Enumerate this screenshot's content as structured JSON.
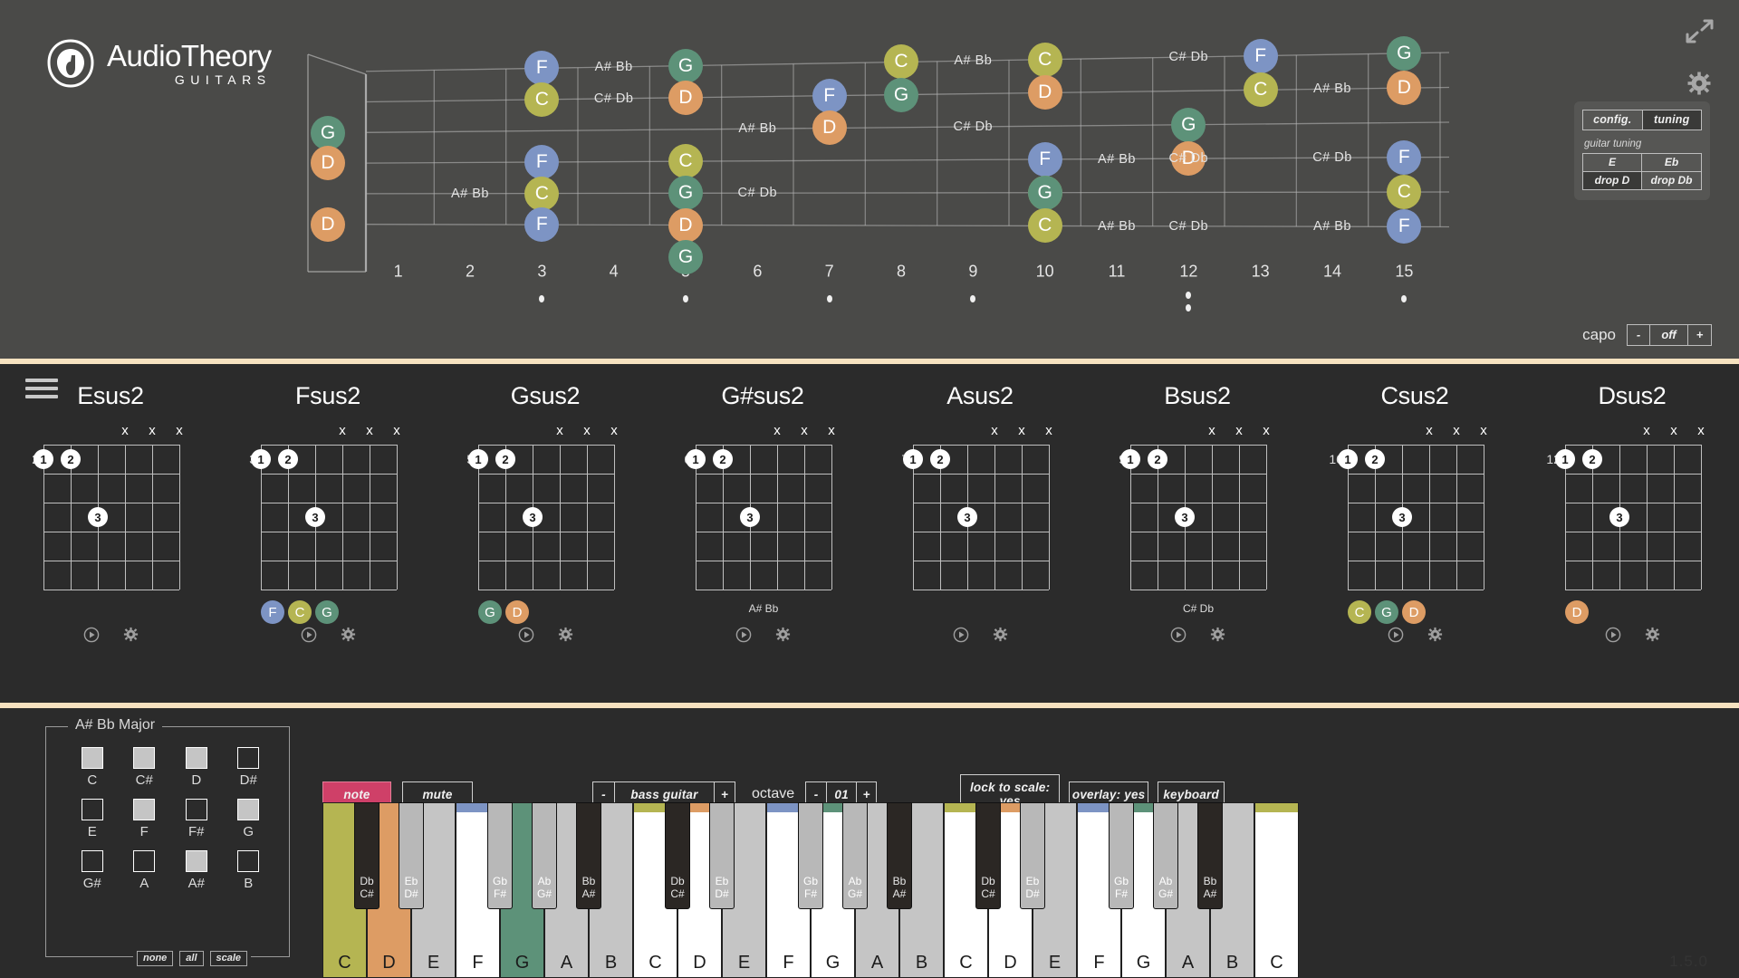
{
  "app": {
    "logo_main": "AudioTheory",
    "logo_sub": "GUITARS",
    "version": "1.5.0"
  },
  "colors": {
    "note_C": "#b5b552",
    "note_D": "#dd9c64",
    "note_F": "#7d94c4",
    "note_G": "#5d9279",
    "accent_pink": "#cf4068",
    "panel_bg": "#4a4a48",
    "dark_bg": "#2b2b2b",
    "cream": "#f6e2c0"
  },
  "fretboard": {
    "fret_numbers": [
      "1",
      "2",
      "3",
      "4",
      "5",
      "6",
      "7",
      "8",
      "9",
      "10",
      "11",
      "12",
      "13",
      "14",
      "15"
    ],
    "inlay_frets": [
      3,
      5,
      7,
      9,
      12,
      15
    ],
    "open_notes": [
      "G",
      "D",
      "D"
    ],
    "notes": [
      {
        "label": "G",
        "fret": 0,
        "string": 2
      },
      {
        "label": "D",
        "fret": 0,
        "string": 3
      },
      {
        "label": "D",
        "fret": 0,
        "string": 5
      },
      {
        "label": "F",
        "fret": 3,
        "string": 0
      },
      {
        "label": "C",
        "fret": 3,
        "string": 1
      },
      {
        "label": "F",
        "fret": 3,
        "string": 3
      },
      {
        "label": "C",
        "fret": 3,
        "string": 4
      },
      {
        "label": "F",
        "fret": 3,
        "string": 5
      },
      {
        "label": "G",
        "fret": 5,
        "string": 0
      },
      {
        "label": "D",
        "fret": 5,
        "string": 1
      },
      {
        "label": "C",
        "fret": 5,
        "string": 3
      },
      {
        "label": "G",
        "fret": 5,
        "string": 4
      },
      {
        "label": "D",
        "fret": 5,
        "string": 5
      },
      {
        "label": "G",
        "fret": 5,
        "string": 6
      },
      {
        "label": "F",
        "fret": 7,
        "string": 1
      },
      {
        "label": "C",
        "fret": 8,
        "string": 0
      },
      {
        "label": "G",
        "fret": 8,
        "string": 1
      },
      {
        "label": "D",
        "fret": 7,
        "string": 2
      },
      {
        "label": "C",
        "fret": 10,
        "string": 0
      },
      {
        "label": "D",
        "fret": 10,
        "string": 1
      },
      {
        "label": "F",
        "fret": 10,
        "string": 3
      },
      {
        "label": "C",
        "fret": 10,
        "string": 4
      },
      {
        "label": "G",
        "fret": 10,
        "string": 4
      },
      {
        "label": "C",
        "fret": 10,
        "string": 5
      },
      {
        "label": "F",
        "fret": 13,
        "string": 0
      },
      {
        "label": "C",
        "fret": 13,
        "string": 1
      },
      {
        "label": "G",
        "fret": 12,
        "string": 2
      },
      {
        "label": "D",
        "fret": 12,
        "string": 3
      },
      {
        "label": "G",
        "fret": 15,
        "string": 0
      },
      {
        "label": "D",
        "fret": 15,
        "string": 1
      },
      {
        "label": "F",
        "fret": 15,
        "string": 3
      },
      {
        "label": "C",
        "fret": 15,
        "string": 4
      },
      {
        "label": "F",
        "fret": 15,
        "string": 5
      }
    ],
    "accidentals": [
      {
        "label": "C# Db",
        "fret": 4,
        "string": 1
      },
      {
        "label": "A# Bb",
        "fret": 4,
        "string": 0
      },
      {
        "label": "A# Bb",
        "fret": 2,
        "string": 4
      },
      {
        "label": "A# Bb",
        "fret": 6,
        "string": 2
      },
      {
        "label": "C# Db",
        "fret": 6,
        "string": 4
      },
      {
        "label": "A# Bb",
        "fret": 9,
        "string": 0
      },
      {
        "label": "C# Db",
        "fret": 9,
        "string": 2
      },
      {
        "label": "A# Bb",
        "fret": 11,
        "string": 3
      },
      {
        "label": "A# Bb",
        "fret": 11,
        "string": 5
      },
      {
        "label": "C# Db",
        "fret": 12,
        "string": 0
      },
      {
        "label": "C# Db",
        "fret": 12,
        "string": 3
      },
      {
        "label": "C# Db",
        "fret": 12,
        "string": 5
      },
      {
        "label": "A# Bb",
        "fret": 14,
        "string": 1
      },
      {
        "label": "C# Db",
        "fret": 14,
        "string": 3
      },
      {
        "label": "A# Bb",
        "fret": 14,
        "string": 5
      }
    ]
  },
  "top_controls": {
    "expand_icon": "expand-arrows-icon",
    "gear_icon": "gear-icon",
    "tabs": [
      {
        "label": "config.",
        "active": false
      },
      {
        "label": "tuning",
        "active": true
      }
    ],
    "tuning_label": "guitar tuning",
    "tuning_options": [
      {
        "label": "E",
        "active": false
      },
      {
        "label": "Eb",
        "active": false
      },
      {
        "label": "drop D",
        "active": true
      },
      {
        "label": "drop Db",
        "active": false
      }
    ],
    "capo_label": "capo",
    "capo_minus": "-",
    "capo_value": "off",
    "capo_plus": "+"
  },
  "chords": [
    {
      "name": "Esus2",
      "start_fret": "2",
      "mutes": [
        "x",
        "x",
        "x"
      ],
      "mute_strings": [
        3,
        4,
        5
      ],
      "fingers": [
        {
          "n": "1",
          "string": 0,
          "fret": 0
        },
        {
          "n": "2",
          "string": 1,
          "fret": 0
        },
        {
          "n": "3",
          "string": 2,
          "fret": 2
        }
      ],
      "notes": [],
      "accidental": ""
    },
    {
      "name": "Fsus2",
      "start_fret": "3",
      "mutes": [
        "x",
        "x",
        "x"
      ],
      "mute_strings": [
        3,
        4,
        5
      ],
      "fingers": [
        {
          "n": "1",
          "string": 0,
          "fret": 0
        },
        {
          "n": "2",
          "string": 1,
          "fret": 0
        },
        {
          "n": "3",
          "string": 2,
          "fret": 2
        }
      ],
      "notes": [
        "F",
        "C",
        "G"
      ],
      "accidental": ""
    },
    {
      "name": "Gsus2",
      "start_fret": "5",
      "mutes": [
        "x",
        "x",
        "x"
      ],
      "mute_strings": [
        3,
        4,
        5
      ],
      "fingers": [
        {
          "n": "1",
          "string": 0,
          "fret": 0
        },
        {
          "n": "2",
          "string": 1,
          "fret": 0
        },
        {
          "n": "3",
          "string": 2,
          "fret": 2
        }
      ],
      "notes": [
        "G",
        "D"
      ],
      "accidental": ""
    },
    {
      "name": "G#sus2",
      "start_fret": "6",
      "mutes": [
        "x",
        "x",
        "x"
      ],
      "mute_strings": [
        3,
        4,
        5
      ],
      "fingers": [
        {
          "n": "1",
          "string": 0,
          "fret": 0
        },
        {
          "n": "2",
          "string": 1,
          "fret": 0
        },
        {
          "n": "3",
          "string": 2,
          "fret": 2
        }
      ],
      "notes": [],
      "accidental": "A# Bb"
    },
    {
      "name": "Asus2",
      "start_fret": "7",
      "mutes": [
        "x",
        "x",
        "x"
      ],
      "mute_strings": [
        3,
        4,
        5
      ],
      "fingers": [
        {
          "n": "1",
          "string": 0,
          "fret": 0
        },
        {
          "n": "2",
          "string": 1,
          "fret": 0
        },
        {
          "n": "3",
          "string": 2,
          "fret": 2
        }
      ],
      "notes": [],
      "accidental": ""
    },
    {
      "name": "Bsus2",
      "start_fret": "9",
      "mutes": [
        "x",
        "x",
        "x"
      ],
      "mute_strings": [
        3,
        4,
        5
      ],
      "fingers": [
        {
          "n": "1",
          "string": 0,
          "fret": 0
        },
        {
          "n": "2",
          "string": 1,
          "fret": 0
        },
        {
          "n": "3",
          "string": 2,
          "fret": 2
        }
      ],
      "notes": [],
      "accidental": "C# Db"
    },
    {
      "name": "Csus2",
      "start_fret": "10",
      "mutes": [
        "x",
        "x",
        "x"
      ],
      "mute_strings": [
        3,
        4,
        5
      ],
      "fingers": [
        {
          "n": "1",
          "string": 0,
          "fret": 0
        },
        {
          "n": "2",
          "string": 1,
          "fret": 0
        },
        {
          "n": "3",
          "string": 2,
          "fret": 2
        }
      ],
      "notes": [
        "C",
        "G",
        "D"
      ],
      "accidental": ""
    },
    {
      "name": "Dsus2",
      "start_fret": "12",
      "mutes": [
        "x",
        "x",
        "x"
      ],
      "mute_strings": [
        3,
        4,
        5
      ],
      "fingers": [
        {
          "n": "1",
          "string": 0,
          "fret": 0
        },
        {
          "n": "2",
          "string": 1,
          "fret": 0
        },
        {
          "n": "3",
          "string": 2,
          "fret": 2
        }
      ],
      "notes": [
        "D"
      ],
      "accidental": ""
    }
  ],
  "chord_tools": {
    "play_icon": "play-icon",
    "settings_icon": "gear-icon"
  },
  "scale_selector": {
    "title": "A# Bb Major",
    "notes": [
      {
        "label": "C",
        "on": true
      },
      {
        "label": "C#",
        "on": true
      },
      {
        "label": "D",
        "on": true
      },
      {
        "label": "D#",
        "on": false
      },
      {
        "label": "E",
        "on": false
      },
      {
        "label": "F",
        "on": true
      },
      {
        "label": "F#",
        "on": false
      },
      {
        "label": "G",
        "on": true
      },
      {
        "label": "G#",
        "on": false
      },
      {
        "label": "A",
        "on": false
      },
      {
        "label": "A#",
        "on": true
      },
      {
        "label": "B",
        "on": false
      }
    ],
    "actions": [
      "none",
      "all",
      "scale"
    ]
  },
  "toolbar": {
    "note_label": "note",
    "mute_label": "mute",
    "instrument_minus": "-",
    "instrument_name": "bass guitar",
    "instrument_plus": "+",
    "octave_label": "octave",
    "octave_minus": "-",
    "octave_value": "01",
    "octave_plus": "+",
    "lock_label": "lock to scale: yes",
    "overlay_label": "overlay: yes",
    "keyboard_label": "keyboard"
  },
  "piano": {
    "white_keys": [
      {
        "label": "C",
        "fill": "#b5b552",
        "strip": ""
      },
      {
        "label": "D",
        "fill": "#dd9c64",
        "strip": ""
      },
      {
        "label": "E",
        "fill": "#c5c5c5",
        "strip": ""
      },
      {
        "label": "F",
        "fill": "#ffffff",
        "strip": "#7d94c4"
      },
      {
        "label": "G",
        "fill": "#5d9279",
        "strip": ""
      },
      {
        "label": "A",
        "fill": "#c5c5c5",
        "strip": ""
      },
      {
        "label": "B",
        "fill": "#c5c5c5",
        "strip": ""
      },
      {
        "label": "C",
        "fill": "#ffffff",
        "strip": "#b5b552"
      },
      {
        "label": "D",
        "fill": "#ffffff",
        "strip": "#dd9c64"
      },
      {
        "label": "E",
        "fill": "#c5c5c5",
        "strip": ""
      },
      {
        "label": "F",
        "fill": "#ffffff",
        "strip": "#7d94c4"
      },
      {
        "label": "G",
        "fill": "#ffffff",
        "strip": "#5d9279"
      },
      {
        "label": "A",
        "fill": "#c5c5c5",
        "strip": ""
      },
      {
        "label": "B",
        "fill": "#c5c5c5",
        "strip": ""
      },
      {
        "label": "C",
        "fill": "#ffffff",
        "strip": "#b5b552"
      },
      {
        "label": "D",
        "fill": "#ffffff",
        "strip": "#dd9c64"
      },
      {
        "label": "E",
        "fill": "#c5c5c5",
        "strip": ""
      },
      {
        "label": "F",
        "fill": "#ffffff",
        "strip": "#7d94c4"
      },
      {
        "label": "G",
        "fill": "#ffffff",
        "strip": "#5d9279"
      },
      {
        "label": "A",
        "fill": "#c5c5c5",
        "strip": ""
      },
      {
        "label": "B",
        "fill": "#c5c5c5",
        "strip": ""
      },
      {
        "label": "C",
        "fill": "#ffffff",
        "strip": "#b5b552"
      }
    ],
    "black_keys": [
      {
        "top": "Db",
        "bottom": "C#",
        "after": 0,
        "dark": true
      },
      {
        "top": "Eb",
        "bottom": "D#",
        "after": 1,
        "dark": false
      },
      {
        "top": "Gb",
        "bottom": "F#",
        "after": 3,
        "dark": false
      },
      {
        "top": "Ab",
        "bottom": "G#",
        "after": 4,
        "dark": false
      },
      {
        "top": "Bb",
        "bottom": "A#",
        "after": 5,
        "dark": true
      },
      {
        "top": "Db",
        "bottom": "C#",
        "after": 7,
        "dark": true
      },
      {
        "top": "Eb",
        "bottom": "D#",
        "after": 8,
        "dark": false
      },
      {
        "top": "Gb",
        "bottom": "F#",
        "after": 10,
        "dark": false
      },
      {
        "top": "Ab",
        "bottom": "G#",
        "after": 11,
        "dark": false
      },
      {
        "top": "Bb",
        "bottom": "A#",
        "after": 12,
        "dark": true
      },
      {
        "top": "Db",
        "bottom": "C#",
        "after": 14,
        "dark": true
      },
      {
        "top": "Eb",
        "bottom": "D#",
        "after": 15,
        "dark": false
      },
      {
        "top": "Gb",
        "bottom": "F#",
        "after": 17,
        "dark": false
      },
      {
        "top": "Ab",
        "bottom": "G#",
        "after": 18,
        "dark": false
      },
      {
        "top": "Bb",
        "bottom": "A#",
        "after": 19,
        "dark": true
      }
    ]
  }
}
